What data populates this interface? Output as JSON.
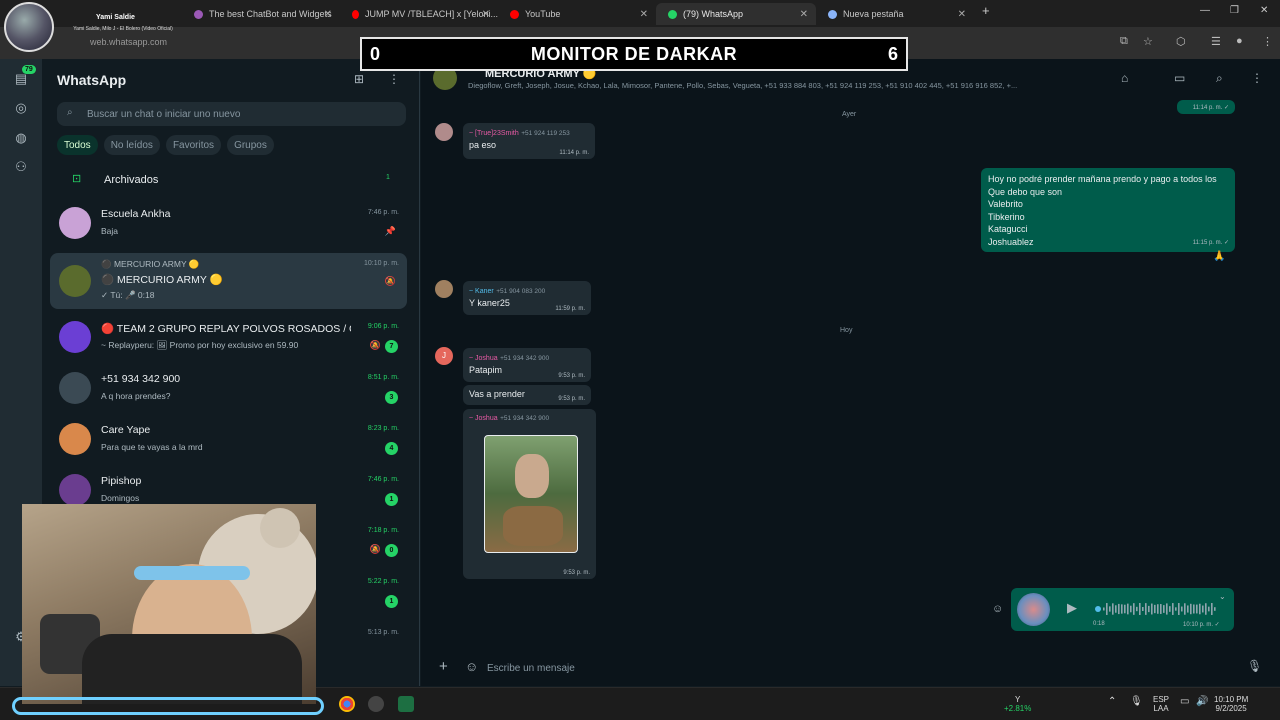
{
  "streamer": {
    "name": "Yami Saldie",
    "subtitle": "Yami Saldie, Milo J - El Bolero (Video Oficial)"
  },
  "browser": {
    "tabs": [
      {
        "label": "The best ChatBot and Widgets",
        "color": "#9b59b6"
      },
      {
        "label": "JUMP MV /TBLEACH] x [Yeloni...",
        "color": "#ff0000"
      },
      {
        "label": "YouTube",
        "color": "#ff0000"
      },
      {
        "label": "(79) WhatsApp",
        "color": "#25d366"
      },
      {
        "label": "Nueva pestaña",
        "color": "#8ab4f8"
      }
    ],
    "url": "web.whatsapp.com"
  },
  "overlay": {
    "left_count": "0",
    "title": "MONITOR DE DARKAR",
    "right_count": "6"
  },
  "rail": {
    "chats_badge": "79"
  },
  "chatlist": {
    "title": "WhatsApp",
    "search_placeholder": "Buscar un chat o iniciar uno nuevo",
    "filters": [
      "Todos",
      "No leídos",
      "Favoritos",
      "Grupos"
    ],
    "archived": {
      "label": "Archivados",
      "count": "1"
    },
    "chats": [
      {
        "name": "Escuela Ankha",
        "preview": "Baja",
        "time": "7:46 p. m.",
        "time_green": false,
        "badge": "",
        "pinned": true,
        "muted": false,
        "avatar_color": "#c9a2d6"
      },
      {
        "name": "⚫ MERCURIO ARMY 🟡",
        "preview": "✓ Tú: 🎤 0:18",
        "group_line": "⚫ MERCURIO ARMY 🟡",
        "time": "10:10 p. m.",
        "time_green": false,
        "badge": "",
        "pinned": false,
        "muted": true,
        "avatar_color": "#5a6b2d"
      },
      {
        "name": "🔴 TEAM 2 GRUPO REPLAY POLVOS ROSADOS / CE...",
        "preview": "~ Replayperu: 🖼 Promo por hoy exclusivo en 59.90",
        "time": "9:06 p. m.",
        "time_green": true,
        "badge": "7",
        "pinned": false,
        "muted": true,
        "avatar_color": "#6b3fd4"
      },
      {
        "name": "+51 934 342 900",
        "preview": "A q hora prendes?",
        "time": "8:51 p. m.",
        "time_green": true,
        "badge": "3",
        "pinned": false,
        "muted": false,
        "avatar_color": "#3b4a54"
      },
      {
        "name": "Care Yape",
        "preview": "Para que te vayas a la mrd",
        "time": "8:23 p. m.",
        "time_green": true,
        "badge": "4",
        "pinned": false,
        "muted": false,
        "avatar_color": "#d9884b"
      },
      {
        "name": "Pipishop",
        "preview": "Domingos",
        "time": "7:46 p. m.",
        "time_green": true,
        "badge": "1",
        "pinned": false,
        "muted": false,
        "avatar_color": "#6a3d8f"
      },
      {
        "name": "",
        "preview": "",
        "time": "7:18 p. m.",
        "time_green": true,
        "badge": "0",
        "pinned": false,
        "muted": true,
        "avatar_color": "#333"
      },
      {
        "name": "",
        "preview": "",
        "time": "5:22 p. m.",
        "time_green": true,
        "badge": "1",
        "pinned": false,
        "muted": false,
        "avatar_color": "#333"
      },
      {
        "name": "",
        "preview": "",
        "time": "5:13 p. m.",
        "time_green": false,
        "badge": "",
        "pinned": false,
        "muted": false,
        "avatar_color": "#333"
      }
    ]
  },
  "conversation": {
    "name": "MERCURIO ARMY 🟡",
    "members": "Diegoflow, Greft, Joseph, Josue, Kchao, Lala, Mimosor, Pantene, Pollo, Sebas, Vegueta, +51 933 884 803, +51 924 119 253, +51 910 402 445, +51 916 916 852, +...",
    "top_time": "11:14 p. m. ✓",
    "day_ayer": "Ayer",
    "day_hoy": "Hoy",
    "msg1": {
      "sender": "~ [True]23Smith",
      "phone": "+51 924 119 253",
      "text": "pa eso",
      "time": "11:14 p. m."
    },
    "out1": {
      "lines": [
        "Hoy no podré prender mañana prendo y pago a todos los",
        "Que debo que son",
        "Valebrito",
        "Tibkerino",
        "Katagucci",
        "Joshuablez"
      ],
      "time": "11:15 p. m. ✓",
      "reaction": "🙏"
    },
    "msg2": {
      "sender": "~ Kaner",
      "phone": "+51 904 083 200",
      "text": "Y kaner25",
      "time": "11:59 p. m."
    },
    "msg3": {
      "sender": "~ Joshua",
      "phone": "+51 934 342 900",
      "text": "Patapim",
      "time": "9:53 p. m.",
      "avatar_letter": "J"
    },
    "msg4": {
      "text": "Vas a prender",
      "time": "9:53 p. m."
    },
    "msg5": {
      "sender": "~ Joshua",
      "phone": "+51 934 342 900",
      "time": "9:53 p. m."
    },
    "voice": {
      "duration": "0:18",
      "time": "10:10 p. m. ✓"
    },
    "composer_placeholder": "Escribe un mensaje"
  },
  "taskbar": {
    "stock": "Y",
    "stock_change": "+2.81%",
    "lang": "ESP",
    "lang2": "LAA",
    "time": "10:10 PM",
    "date": "9/2/2025"
  }
}
